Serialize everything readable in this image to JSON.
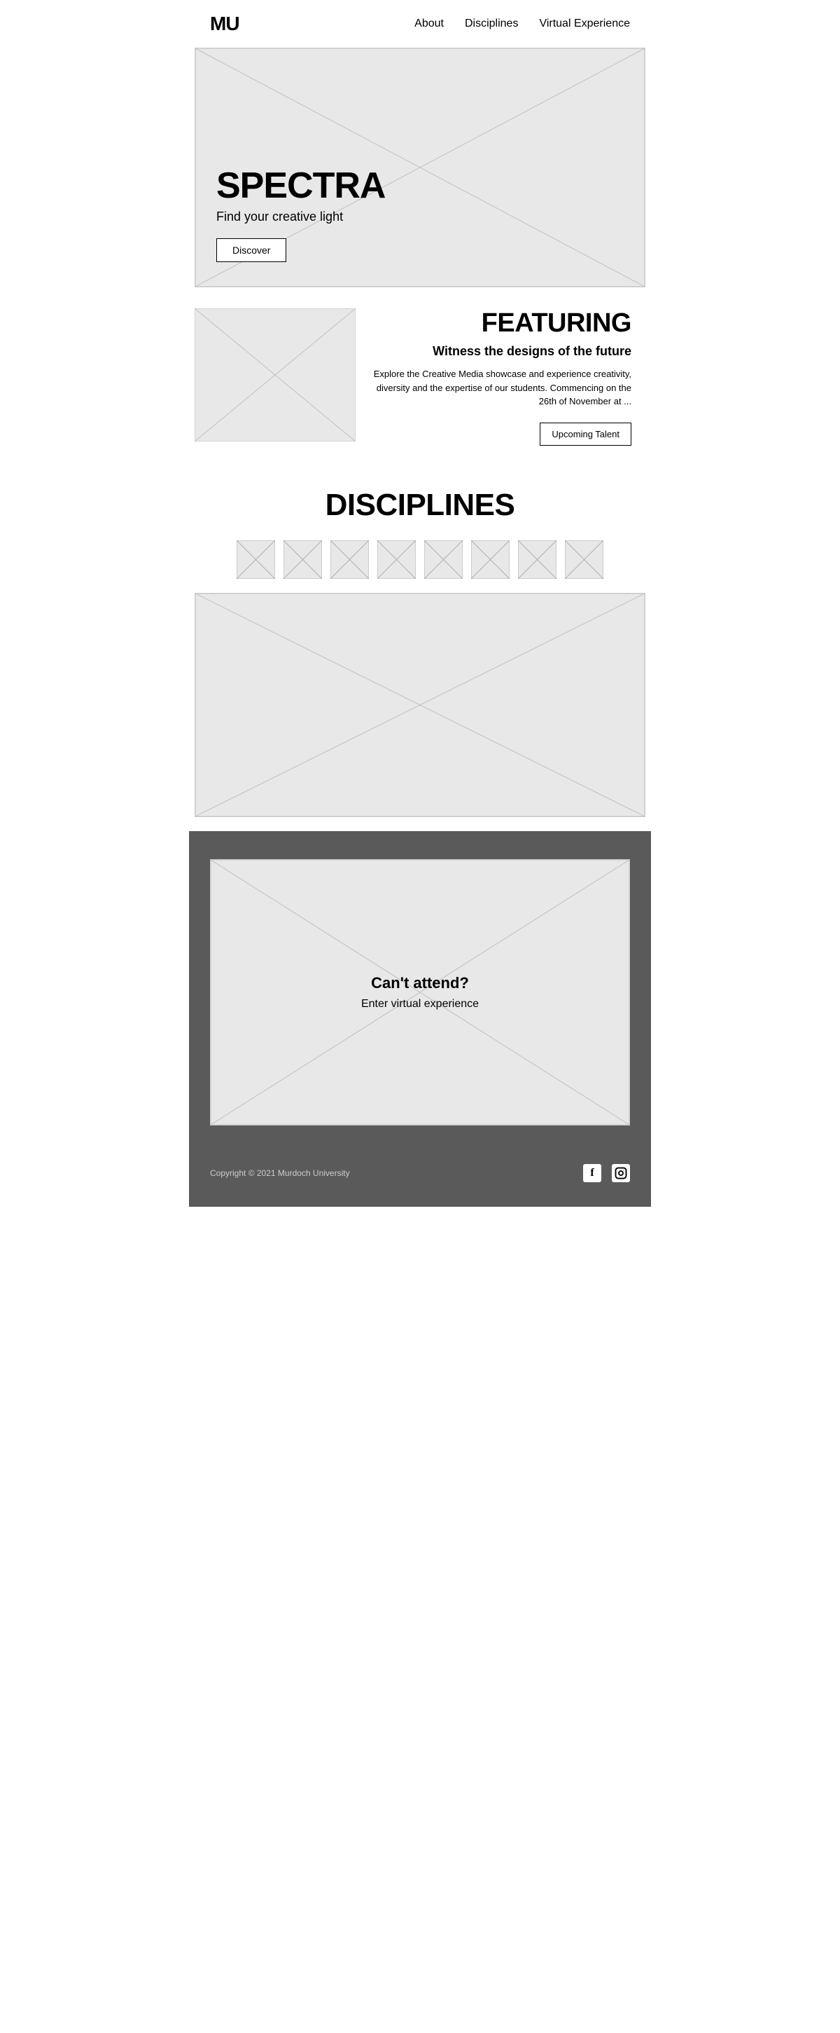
{
  "nav": {
    "logo": "MU",
    "links": [
      {
        "label": "About",
        "id": "about"
      },
      {
        "label": "Disciplines",
        "id": "disciplines"
      },
      {
        "label": "Virtual Experience",
        "id": "virtual-experience"
      }
    ]
  },
  "hero": {
    "title": "SPECTRA",
    "subtitle": "Find your creative light",
    "button_label": "Discover"
  },
  "featuring": {
    "section_title": "FEATURING",
    "subtitle": "Witness the designs of the future",
    "body": "Explore the Creative Media showcase and experience creativity, diversity and the expertise of our students. Commencing on the 26th of November at ...",
    "button_label": "Upcoming Talent"
  },
  "disciplines": {
    "title": "DISCIPLINES",
    "icon_count": 8
  },
  "virtual": {
    "title": "Can't attend?",
    "subtitle": "Enter virtual experience"
  },
  "footer": {
    "copyright": "Copyright © 2021 Murdoch University"
  },
  "social_icons": [
    {
      "name": "facebook",
      "symbol": "f"
    },
    {
      "name": "instagram",
      "symbol": "◻"
    }
  ]
}
